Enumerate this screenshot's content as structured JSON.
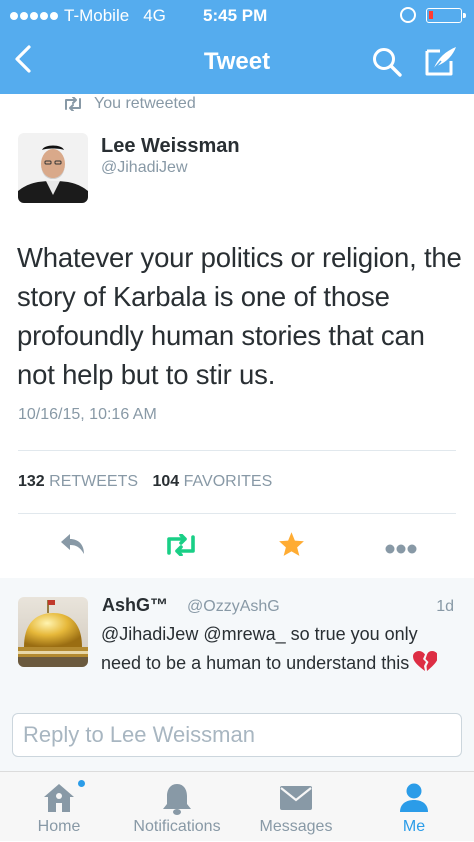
{
  "status_bar": {
    "carrier": "T-Mobile",
    "network": "4G",
    "time": "5:45 PM"
  },
  "nav": {
    "title": "Tweet"
  },
  "retweet_note": "You retweeted",
  "tweet": {
    "author_name": "Lee Weissman",
    "author_handle": "@JihadiJew",
    "text": "Whatever your politics or religion, the story of Karbala is one of those profoundly human stories that can not help but to stir us.",
    "timestamp": "10/16/15, 10:16 AM",
    "retweets_count": "132",
    "retweets_label": "RETWEETS",
    "favorites_count": "104",
    "favorites_label": "FAVORITES",
    "favorited": true
  },
  "reply": {
    "name": "AshG™",
    "handle": "@OzzyAshG",
    "time": "1d",
    "text": "@JihadiJew @mrewa_ so true you only need to be a human to understand this"
  },
  "reply_input": {
    "placeholder": "Reply to Lee Weissman"
  },
  "tabs": [
    {
      "label": "Home",
      "icon": "home-icon"
    },
    {
      "label": "Notifications",
      "icon": "bell-icon"
    },
    {
      "label": "Messages",
      "icon": "envelope-icon"
    },
    {
      "label": "Me",
      "icon": "person-icon",
      "active": true
    }
  ],
  "colors": {
    "brand": "#55acee",
    "retweet_green": "#19cf86",
    "favorite_gold": "#ffac33",
    "active_tab": "#2b9ce8"
  }
}
